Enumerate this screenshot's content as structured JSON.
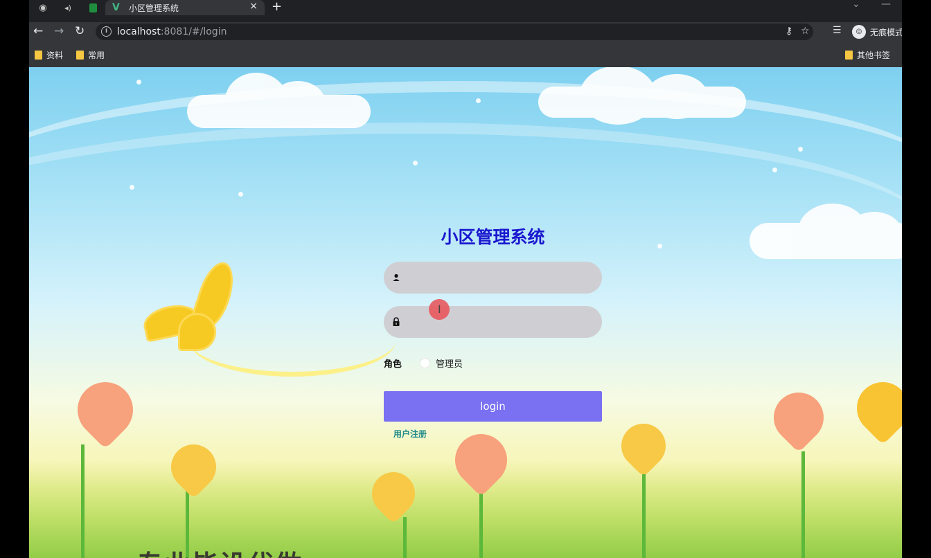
{
  "browser": {
    "tab": {
      "title": "小区管理系统",
      "close": "×"
    },
    "new_tab": "+",
    "address": {
      "host": "localhost",
      "path": ":8081/#/login"
    },
    "incognito_label": "无痕模式",
    "bookmarks": [
      {
        "label": "资料"
      },
      {
        "label": "常用"
      }
    ],
    "other_bookmarks": "其他书签"
  },
  "login": {
    "title": "小区管理系统",
    "username_value": "",
    "password_value": "",
    "role_label": "角色",
    "role_option": "管理员",
    "button_label": "login",
    "register_link": "用户注册"
  },
  "background": {
    "slogan": "专业毕设代做"
  },
  "colors": {
    "title": "#1a17cf",
    "button": "#7970f2",
    "register_link": "#1e8a8a",
    "field": "#cfcfd3"
  },
  "icons": {
    "username": "user-icon",
    "password": "lock-icon"
  }
}
